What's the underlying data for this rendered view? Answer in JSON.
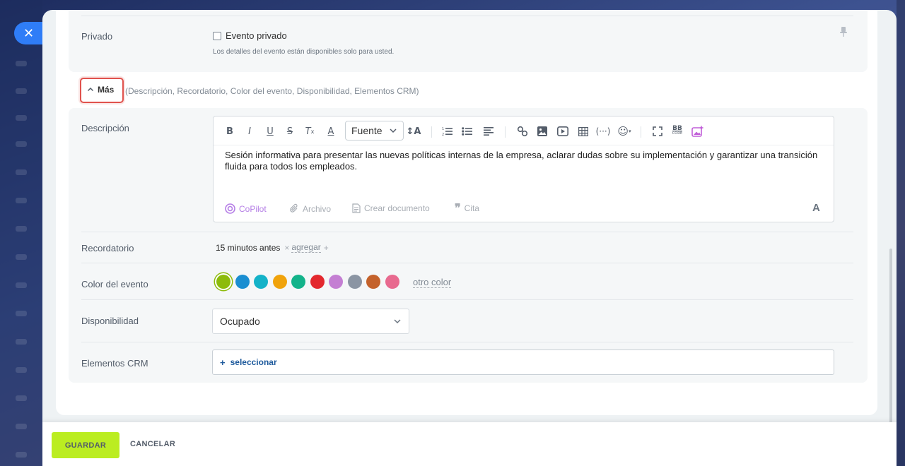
{
  "privado": {
    "label": "Privado",
    "checkbox_label": "Evento privado",
    "checked": false,
    "hint": "Los detalles del evento están disponibles solo para usted."
  },
  "more": {
    "label": "Más",
    "summary": "(Descripción, Recordatorio, Color del evento, Disponibilidad, Elementos CRM)"
  },
  "description": {
    "label": "Descripción",
    "font_select": "Fuente",
    "text": "Sesión informativa para presentar las nuevas políticas internas de la empresa, aclarar dudas sobre su implementación y garantizar una transición fluida para todos los empleados.",
    "footer": {
      "copilot": "CoPilot",
      "archivo": "Archivo",
      "crear_documento": "Crear documento",
      "cita": "Cita",
      "format": "A"
    }
  },
  "reminder": {
    "label": "Recordatorio",
    "value": "15 minutos antes",
    "add": "agregar"
  },
  "event_color": {
    "label": "Color del evento",
    "colors": [
      "#8dbb0b",
      "#1a8ed1",
      "#14b2c8",
      "#f0a30c",
      "#13b38a",
      "#e3282e",
      "#c47fd3",
      "#8b95a3",
      "#c4622b",
      "#e86a8f"
    ],
    "selected_index": 0,
    "other": "otro color"
  },
  "availability": {
    "label": "Disponibilidad",
    "value": "Ocupado"
  },
  "crm": {
    "label": "Elementos CRM",
    "select": "seleccionar"
  },
  "footer": {
    "save": "GUARDAR",
    "cancel": "CANCELAR"
  }
}
